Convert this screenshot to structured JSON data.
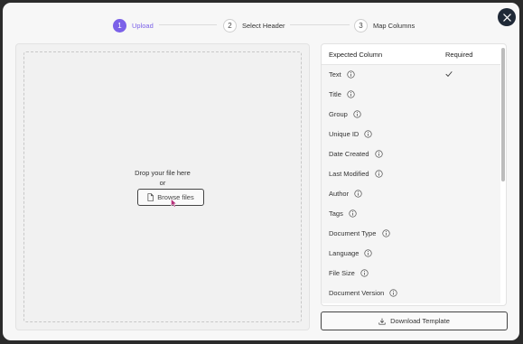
{
  "stepper": {
    "steps": [
      {
        "number": "1",
        "label": "Upload",
        "active": true
      },
      {
        "number": "2",
        "label": "Select Header",
        "active": false
      },
      {
        "number": "3",
        "label": "Map Columns",
        "active": false
      }
    ]
  },
  "upload": {
    "drop_text": "Drop your file here",
    "or_text": "or",
    "browse_label": "Browse files"
  },
  "columns": {
    "header_expected": "Expected Column",
    "header_required": "Required",
    "rows": [
      {
        "label": "Text",
        "required": true
      },
      {
        "label": "Title",
        "required": false
      },
      {
        "label": "Group",
        "required": false
      },
      {
        "label": "Unique ID",
        "required": false
      },
      {
        "label": "Date Created",
        "required": false
      },
      {
        "label": "Last Modified",
        "required": false
      },
      {
        "label": "Author",
        "required": false
      },
      {
        "label": "Tags",
        "required": false
      },
      {
        "label": "Document Type",
        "required": false
      },
      {
        "label": "Language",
        "required": false
      },
      {
        "label": "File Size",
        "required": false
      },
      {
        "label": "Document Version",
        "required": false
      }
    ]
  },
  "download_label": "Download Template",
  "colors": {
    "accent": "#7b61e8",
    "close_bg": "#1f2937"
  },
  "icons": {
    "close": "close-icon",
    "file": "file-icon",
    "info": "info-icon",
    "check": "check-icon",
    "download": "download-icon"
  }
}
